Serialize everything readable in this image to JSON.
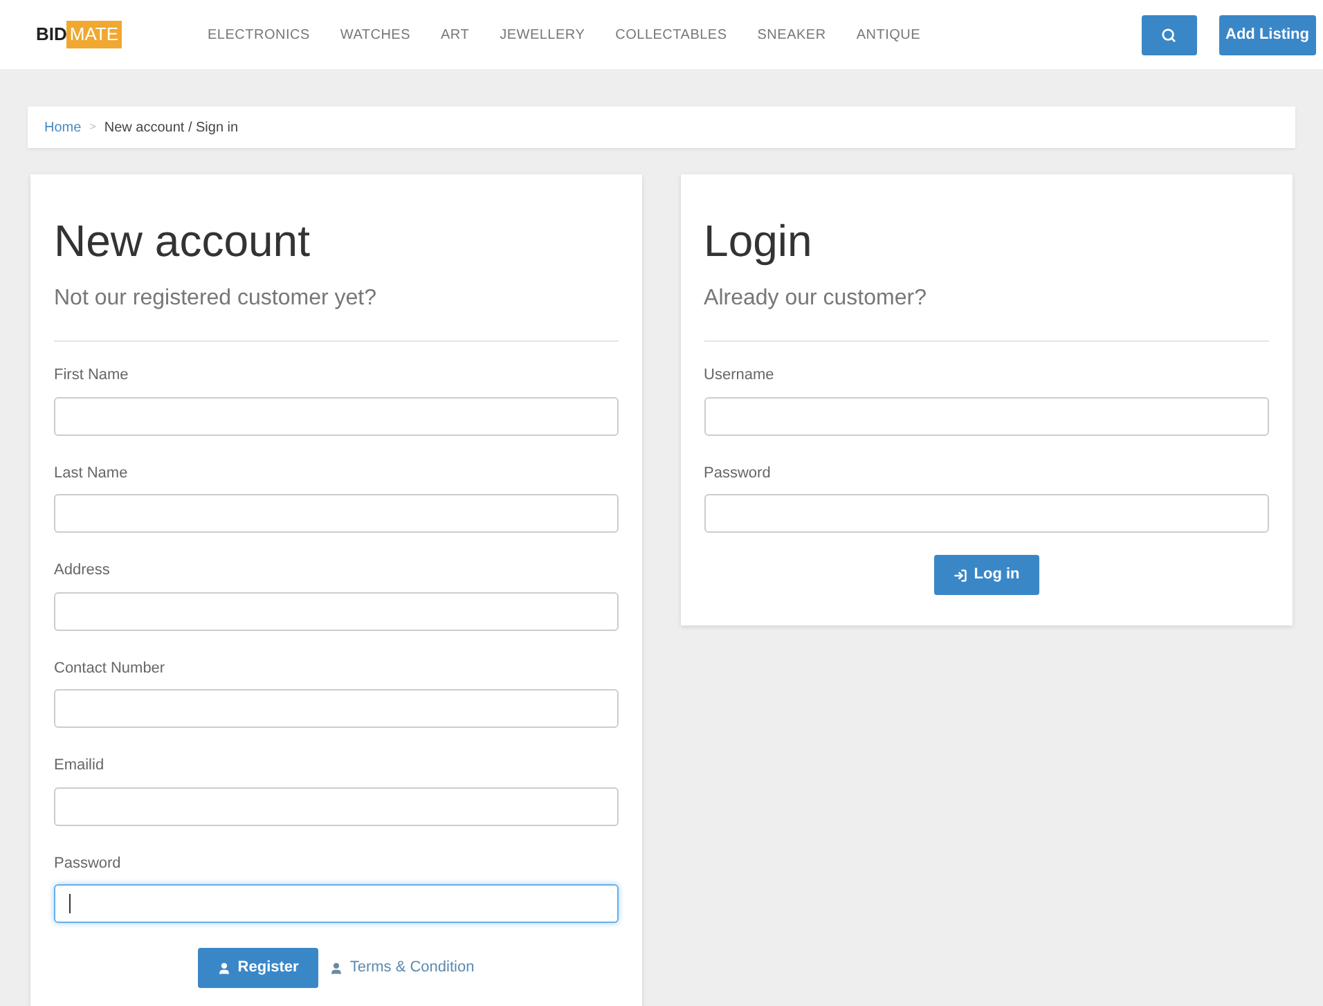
{
  "header": {
    "logo": {
      "dark": "BID",
      "highlight": "MATE"
    },
    "nav": [
      {
        "label": "ELECTRONICS"
      },
      {
        "label": "WATCHES"
      },
      {
        "label": "ART"
      },
      {
        "label": "JEWELLERY"
      },
      {
        "label": "COLLECTABLES"
      },
      {
        "label": "SNEAKER"
      },
      {
        "label": "ANTIQUE"
      }
    ],
    "add_listing": "Add Listing"
  },
  "breadcrumb": {
    "home": "Home",
    "separator": ">",
    "current": "New account / Sign in"
  },
  "register": {
    "title": "New account",
    "subtitle": "Not our registered customer yet?",
    "fields": [
      {
        "label": "First Name",
        "focused": false
      },
      {
        "label": "Last Name",
        "focused": false
      },
      {
        "label": "Address",
        "focused": false
      },
      {
        "label": "Contact Number",
        "focused": false
      },
      {
        "label": "Emailid",
        "focused": false
      },
      {
        "label": "Password",
        "focused": true
      }
    ],
    "button": "Register",
    "terms_link": "Terms & Condition"
  },
  "login": {
    "title": "Login",
    "subtitle": "Already our customer?",
    "fields": [
      {
        "label": "Username",
        "focused": false
      },
      {
        "label": "Password",
        "focused": false
      }
    ],
    "button": "Log in"
  }
}
